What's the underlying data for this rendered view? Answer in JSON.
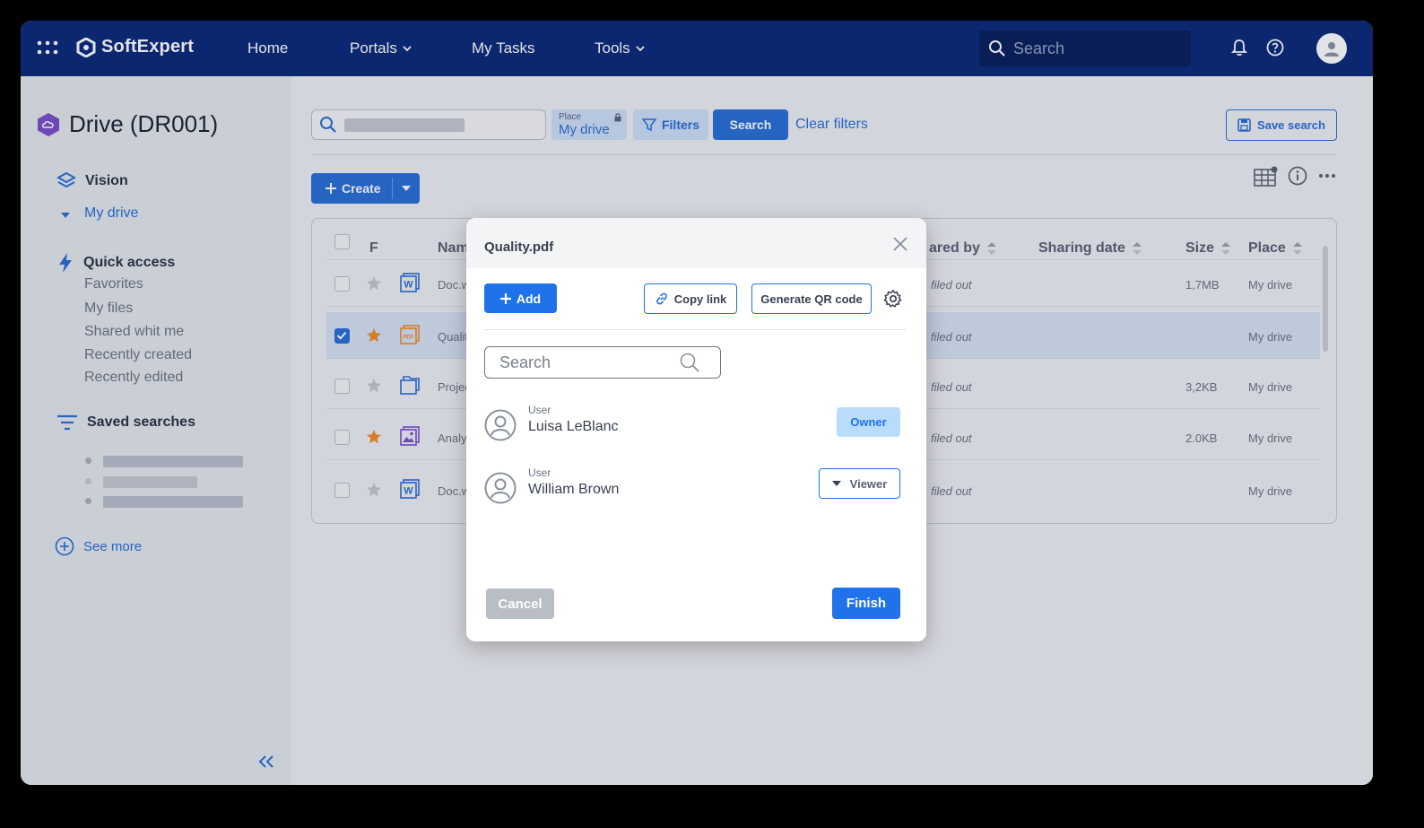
{
  "topbar": {
    "brand": "SoftExpert",
    "nav": {
      "home": "Home",
      "portals": "Portals",
      "my_tasks": "My Tasks",
      "tools": "Tools"
    },
    "search_placeholder": "Search"
  },
  "sidebar": {
    "title": "Drive (DR001)",
    "vision": "Vision",
    "my_drive": "My drive",
    "quick_access": "Quick access",
    "quick_items": [
      "Favorites",
      "My files",
      "Shared whit me",
      "Recently created",
      "Recently edited"
    ],
    "saved_searches": "Saved searches",
    "see_more": "See more"
  },
  "toolbar": {
    "place_label": "Place",
    "place_value": "My drive",
    "filters": "Filters",
    "search": "Search",
    "clear_filters": "Clear filters",
    "save_search": "Save search",
    "create": "Create"
  },
  "table": {
    "headers": {
      "f": "F",
      "name": "Nam",
      "shared_by": "ared by",
      "sharing_date": "Sharing date",
      "size": "Size",
      "place": "Place"
    },
    "rows": [
      {
        "name": "Doc.w",
        "status": "filed out",
        "size": "1,7MB",
        "place": "My drive",
        "starred": false,
        "selected": false
      },
      {
        "name": "Qualit",
        "status": "filed out",
        "size": "",
        "place": "My drive",
        "starred": true,
        "selected": true
      },
      {
        "name": "Projec",
        "status": "filed out",
        "size": "3,2KB",
        "place": "My drive",
        "starred": false,
        "selected": false
      },
      {
        "name": "Analyt",
        "status": "filed out",
        "size": "2.0KB",
        "place": "My drive",
        "starred": true,
        "selected": false
      },
      {
        "name": "Doc.w",
        "status": "filed out",
        "size": "",
        "place": "My drive",
        "starred": false,
        "selected": false
      }
    ]
  },
  "modal": {
    "title": "Quality.pdf",
    "add": "Add",
    "copy_link": "Copy link",
    "generate_qr": "Generate QR code",
    "search_placeholder": "Search",
    "users": [
      {
        "type": "User",
        "name": "Luisa LeBlanc",
        "role": "Owner"
      },
      {
        "type": "User",
        "name": "William Brown",
        "role": "Viewer"
      }
    ],
    "cancel": "Cancel",
    "finish": "Finish"
  },
  "colors": {
    "topbar": "#0b2a78",
    "primary": "#2a6fd6",
    "modal_primary": "#1f72ea",
    "star": "#f08c2a"
  }
}
